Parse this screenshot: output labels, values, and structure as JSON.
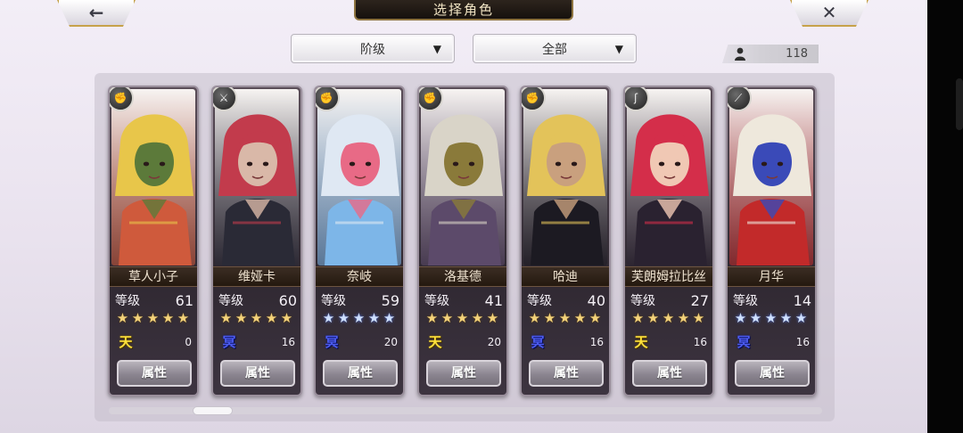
{
  "header": {
    "back_icon": "←",
    "close_icon": "✕",
    "title": "选择角色"
  },
  "filters": {
    "rank_label": "阶级",
    "scope_label": "全部",
    "caret": "▼"
  },
  "roster_count": "118",
  "scroll_progress": 0.12,
  "characters": [
    {
      "name": "草人小子",
      "level_label": "等级",
      "level": "61",
      "stars": 5,
      "star_color": "gold",
      "element": "天",
      "element_type": "heaven",
      "element_count": "0",
      "attr_label": "属性",
      "badge_icon": "gauntlet-icon",
      "palette": [
        "#e8c64a",
        "#cf5a3c",
        "#5c7a3a"
      ]
    },
    {
      "name": "维娅卡",
      "level_label": "等级",
      "level": "60",
      "stars": 5,
      "star_color": "gold",
      "element": "冥",
      "element_type": "hades",
      "element_count": "16",
      "attr_label": "属性",
      "badge_icon": "swords-icon",
      "palette": [
        "#c23b4c",
        "#2a2a36",
        "#d9b8a8"
      ]
    },
    {
      "name": "奈岐",
      "level_label": "等级",
      "level": "59",
      "stars": 5,
      "star_color": "blue",
      "element": "冥",
      "element_type": "hades",
      "element_count": "20",
      "attr_label": "属性",
      "badge_icon": "gauntlet-icon",
      "palette": [
        "#dfe8f3",
        "#7db6e8",
        "#e86a86"
      ]
    },
    {
      "name": "洛基德",
      "level_label": "等级",
      "level": "41",
      "stars": 5,
      "star_color": "gold",
      "element": "天",
      "element_type": "heaven",
      "element_count": "20",
      "attr_label": "属性",
      "badge_icon": "gauntlet-icon",
      "palette": [
        "#d9d4c8",
        "#5c4a6a",
        "#8a7a3a"
      ]
    },
    {
      "name": "哈迪",
      "level_label": "等级",
      "level": "40",
      "stars": 5,
      "star_color": "gold",
      "element": "冥",
      "element_type": "hades",
      "element_count": "16",
      "attr_label": "属性",
      "badge_icon": "gauntlet-icon",
      "palette": [
        "#e3c35a",
        "#1c1a22",
        "#c9a07e"
      ]
    },
    {
      "name": "芙朗姆拉比丝",
      "level_label": "等级",
      "level": "27",
      "stars": 5,
      "star_color": "gold",
      "element": "天",
      "element_type": "heaven",
      "element_count": "16",
      "attr_label": "属性",
      "badge_icon": "hook-icon",
      "palette": [
        "#d42e4a",
        "#2a2230",
        "#f0c8b4"
      ]
    },
    {
      "name": "月华",
      "level_label": "等级",
      "level": "14",
      "stars": 5,
      "star_color": "blue",
      "element": "冥",
      "element_type": "hades",
      "element_count": "16",
      "attr_label": "属性",
      "badge_icon": "blade-icon",
      "palette": [
        "#eee8dc",
        "#c22a2a",
        "#3a4ab8"
      ]
    }
  ]
}
